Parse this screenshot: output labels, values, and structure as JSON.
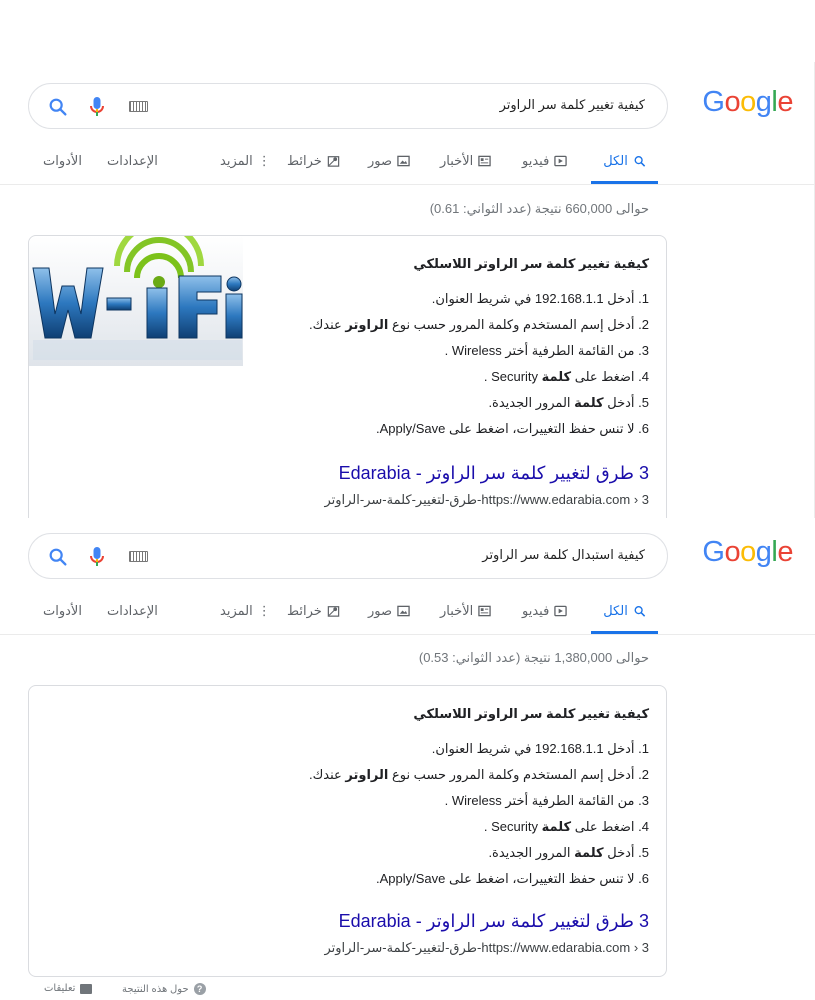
{
  "logo": {
    "letters": [
      "G",
      "o",
      "o",
      "g",
      "l",
      "e"
    ],
    "colors": [
      "#4285f4",
      "#ea4335",
      "#fbbc05",
      "#4285f4",
      "#34a853",
      "#ea4335"
    ]
  },
  "tabs": {
    "all": "الكل",
    "videos": "فيديو",
    "news": "الأخبار",
    "images": "صور",
    "maps": "خرائط",
    "more": "المزيد",
    "settings": "الإعدادات",
    "tools": "الأدوات"
  },
  "icons": {
    "search": "search-icon",
    "mic": "microphone-icon",
    "keyboard": "keyboard-icon",
    "more": "vertical-dots-icon"
  },
  "colors": {
    "accent": "#1a73e8",
    "link": "#1a0dab",
    "muted": "#70757a"
  },
  "panels": [
    {
      "query": "كيفية تغيير كلمة سر الراوتر",
      "stats": "حوالى 660,000 نتيجة (عدد الثواني: 0.61)",
      "card": {
        "title": "كيفية تغيير كلمة سر الراوتر اللاسلكي",
        "image_alt": "WI-FI",
        "steps": [
          {
            "num": "1.",
            "pre": "أدخل 192.168.1.1 في شريط العنوان.",
            "bold": "",
            "post": ""
          },
          {
            "num": "2.",
            "pre": "أدخل إسم المستخدم وكلمة المرور حسب نوع ",
            "bold": "الراوتر",
            "post": " عندك."
          },
          {
            "num": "3.",
            "pre": "من القائمة الطرفية أختر Wireless .",
            "bold": "",
            "post": ""
          },
          {
            "num": "4.",
            "pre": "اضغط على ",
            "bold": "كلمة",
            "post": " Security ."
          },
          {
            "num": "5.",
            "pre": "أدخل ",
            "bold": "كلمة",
            "post": " المرور الجديدة."
          },
          {
            "num": "6.",
            "pre": "لا تنس حفظ التغييرات، اضغط على Apply/Save.",
            "bold": "",
            "post": ""
          }
        ],
        "link": "3 طرق لتغيير كلمة سر الراوتر - Edarabia",
        "url": "https://www.edarabia.com › 3-طرق-لتغيير-كلمة-سر-الراوتر"
      }
    },
    {
      "query": "كيفية استبدال كلمة سر الراوتر",
      "stats": "حوالى 1,380,000 نتيجة (عدد الثواني: 0.53)",
      "card": {
        "title": "كيفية تغيير كلمة سر الراوتر اللاسلكي",
        "steps": [
          {
            "num": "1.",
            "pre": "أدخل 192.168.1.1 في شريط العنوان.",
            "bold": "",
            "post": ""
          },
          {
            "num": "2.",
            "pre": "أدخل إسم المستخدم وكلمة المرور حسب نوع ",
            "bold": "الراوتر",
            "post": " عندك."
          },
          {
            "num": "3.",
            "pre": "من القائمة الطرفية أختر Wireless .",
            "bold": "",
            "post": ""
          },
          {
            "num": "4.",
            "pre": "اضغط على ",
            "bold": "كلمة",
            "post": " Security ."
          },
          {
            "num": "5.",
            "pre": "أدخل ",
            "bold": "كلمة",
            "post": " المرور الجديدة."
          },
          {
            "num": "6.",
            "pre": "لا تنس حفظ التغييرات، اضغط على Apply/Save.",
            "bold": "",
            "post": ""
          }
        ],
        "link": "3 طرق لتغيير كلمة سر الراوتر - Edarabia",
        "url": "https://www.edarabia.com › 3-طرق-لتغيير-كلمة-سر-الراوتر"
      },
      "footer": {
        "about": "حول هذه النتيجة",
        "feedback": "تعليقات"
      }
    }
  ]
}
